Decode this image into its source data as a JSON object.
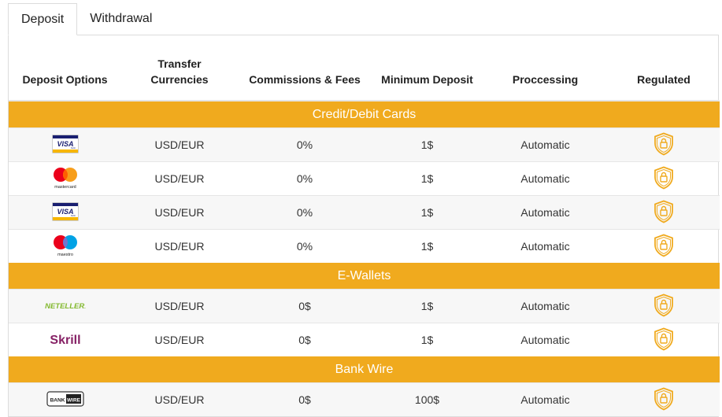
{
  "tabs": [
    {
      "label": "Deposit",
      "active": true
    },
    {
      "label": "Withdrawal",
      "active": false
    }
  ],
  "columns": [
    "Deposit Options",
    "Transfer Currencies",
    "Commissions & Fees",
    "Minimum Deposit",
    "Proccessing",
    "Regulated"
  ],
  "columns_display": [
    "Deposit Options",
    "Transfer\nCurrencies",
    "Commissions & Fees",
    "Minimum Deposit",
    "Proccessing",
    "Regulated"
  ],
  "sections": [
    {
      "title": "Credit/Debit Cards",
      "rows": [
        {
          "method": "visa-icon",
          "logo_text": "VISA",
          "currencies": "USD/EUR",
          "fees": "0%",
          "minimum": "1$",
          "processing": "Automatic",
          "regulated": "shield-lock-icon"
        },
        {
          "method": "mastercard-icon",
          "logo_text": "mastercard",
          "currencies": "USD/EUR",
          "fees": "0%",
          "minimum": "1$",
          "processing": "Automatic",
          "regulated": "shield-lock-icon"
        },
        {
          "method": "visa-icon",
          "logo_text": "VISA",
          "currencies": "USD/EUR",
          "fees": "0%",
          "minimum": "1$",
          "processing": "Automatic",
          "regulated": "shield-lock-icon"
        },
        {
          "method": "maestro-icon",
          "logo_text": "maestro",
          "currencies": "USD/EUR",
          "fees": "0%",
          "minimum": "1$",
          "processing": "Automatic",
          "regulated": "shield-lock-icon"
        }
      ]
    },
    {
      "title": "E-Wallets",
      "rows": [
        {
          "method": "neteller-icon",
          "logo_text": "NETELLER",
          "currencies": "USD/EUR",
          "fees": "0$",
          "minimum": "1$",
          "processing": "Automatic",
          "regulated": "shield-lock-icon"
        },
        {
          "method": "skrill-icon",
          "logo_text": "Skrill",
          "currencies": "USD/EUR",
          "fees": "0$",
          "minimum": "1$",
          "processing": "Automatic",
          "regulated": "shield-lock-icon"
        }
      ]
    },
    {
      "title": "Bank Wire",
      "rows": [
        {
          "method": "bankwire-icon",
          "logo_text": "BANKWIRE",
          "currencies": "USD/EUR",
          "fees": "0$",
          "minimum": "100$",
          "processing": "Automatic",
          "regulated": "shield-lock-icon"
        }
      ]
    }
  ],
  "colors": {
    "accent": "#f0aa1e",
    "neteller_green": "#83b92f",
    "skrill_purple": "#862165",
    "visa_blue": "#1a1f71"
  }
}
